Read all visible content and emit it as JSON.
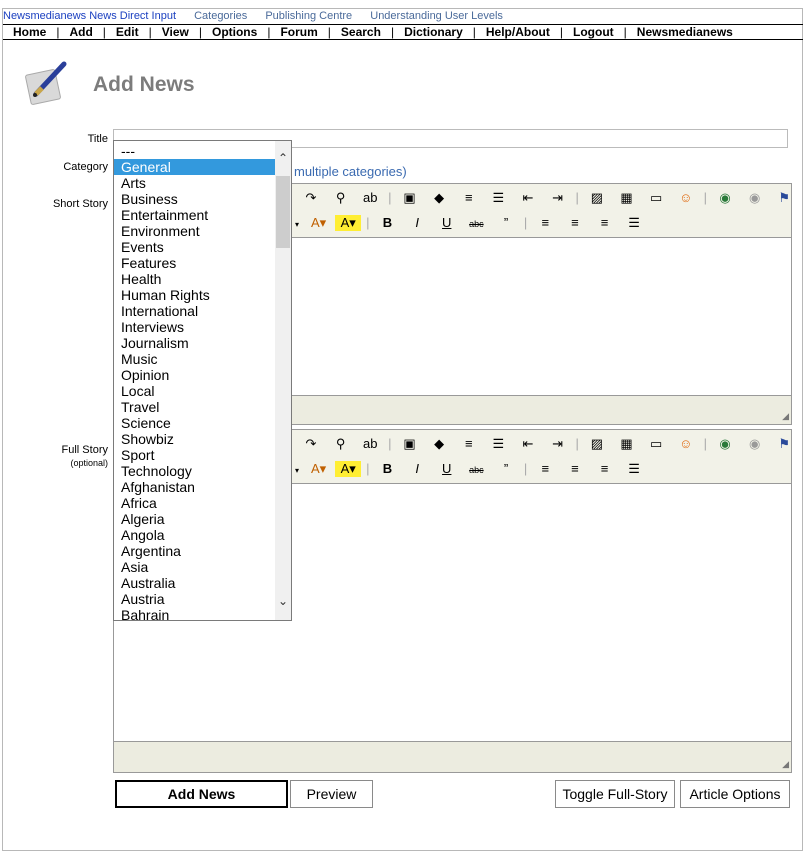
{
  "top_links": {
    "brand": "Newsmedianews News Direct Input",
    "items": [
      "Categories",
      "Publishing Centre",
      "Understanding User Levels"
    ]
  },
  "menu": [
    "Home",
    "Add",
    "Edit",
    "View",
    "Options",
    "Forum",
    "Search",
    "Dictionary",
    "Help/About",
    "Logout",
    "Newsmedianews"
  ],
  "page": {
    "title": "Add News",
    "logo_icon": "quill-pen-icon"
  },
  "form": {
    "title_label": "Title",
    "title_value": "",
    "category_label": "Category",
    "category_hint": "multiple categories)",
    "short_story_label": "Short Story",
    "full_story_label": "Full Story",
    "full_story_note": "(optional)"
  },
  "category_dropdown": {
    "selected": "General",
    "options": [
      "---",
      "General",
      "Arts",
      "Business",
      "Entertainment",
      "Environment",
      "Events",
      "Features",
      "Health",
      "Human Rights",
      "International",
      "Interviews",
      "Journalism",
      "Music",
      "Opinion",
      "Local",
      "Travel",
      "Science",
      "Showbiz",
      "Sport",
      "Technology",
      "Afghanistan",
      "Africa",
      "Algeria",
      "Angola",
      "Argentina",
      "Asia",
      "Australia",
      "Austria",
      "Bahrain"
    ]
  },
  "toolbar": {
    "row1_icons": [
      "redo-icon",
      "find-icon",
      "replace-icon",
      "select-all-icon",
      "eraser-icon",
      "ordered-list-icon",
      "unordered-list-icon",
      "outdent-icon",
      "indent-icon",
      "image-icon",
      "table-icon",
      "horizontal-rule-icon",
      "smiley-icon",
      "link-icon",
      "unlink-icon",
      "anchor-flag-icon"
    ],
    "row2_icons": [
      "font-color-icon",
      "highlight-color-icon",
      "bold-icon",
      "italic-icon",
      "underline-icon",
      "strikethrough-icon",
      "blockquote-icon",
      "align-left-icon",
      "align-center-icon",
      "align-right-icon",
      "justify-icon"
    ]
  },
  "buttons": {
    "add_news": "Add News",
    "preview": "Preview",
    "toggle_full_story": "Toggle Full-Story",
    "article_options": "Article Options"
  },
  "colors": {
    "link_blue": "#3a6ab0",
    "selection_blue": "#3399dd",
    "toolbar_bg": "#f2f2e8"
  }
}
